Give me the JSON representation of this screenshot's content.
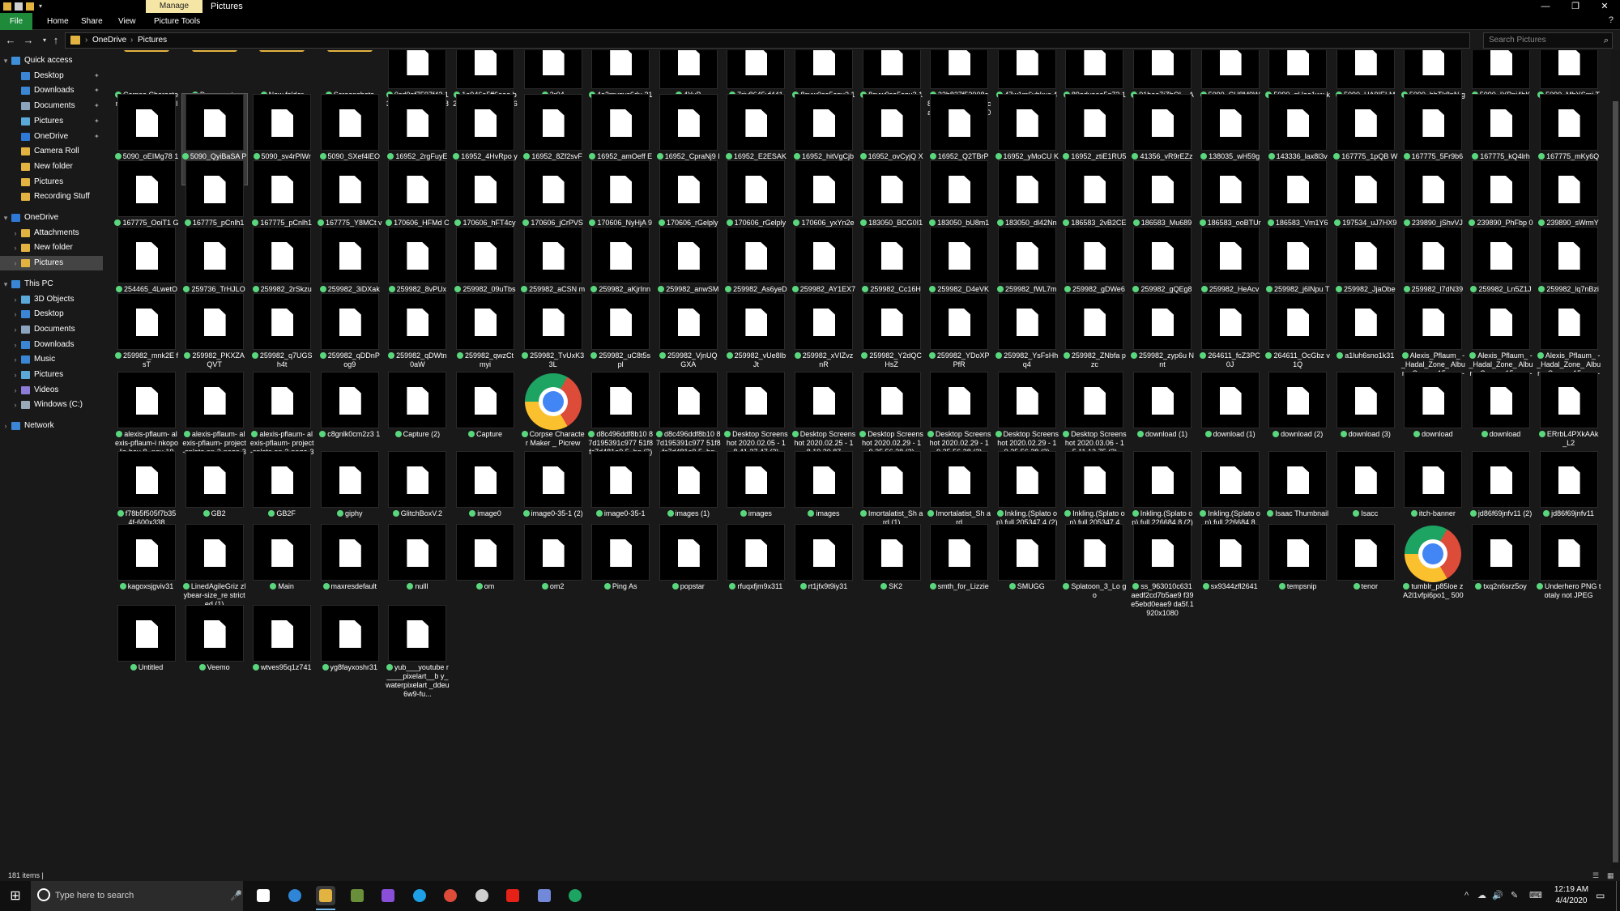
{
  "window": {
    "context_tab": "Manage",
    "title": "Pictures",
    "minimize": "—",
    "maximize": "❐",
    "close": "✕"
  },
  "ribbon": {
    "tabs": [
      "File",
      "Home",
      "Share",
      "View",
      "Picture Tools"
    ],
    "help": "?"
  },
  "address": {
    "crumbs": [
      "OneDrive",
      "Pictures"
    ],
    "separator": "›",
    "search_placeholder": "Search Pictures"
  },
  "nav": {
    "items": [
      {
        "label": "Quick access",
        "indent": 0,
        "icon": "star-icon",
        "color": "#3f8fd8",
        "pin": false,
        "expand": "▾"
      },
      {
        "label": "Desktop",
        "indent": 1,
        "icon": "desktop-icon",
        "color": "#3a86d4",
        "pin": true
      },
      {
        "label": "Downloads",
        "indent": 1,
        "icon": "downloads-icon",
        "color": "#3a86d4",
        "pin": true
      },
      {
        "label": "Documents",
        "indent": 1,
        "icon": "documents-icon",
        "color": "#8ca3bd",
        "pin": true
      },
      {
        "label": "Pictures",
        "indent": 1,
        "icon": "pictures-icon",
        "color": "#5aa9d8",
        "pin": true
      },
      {
        "label": "OneDrive",
        "indent": 1,
        "icon": "onedrive-icon",
        "color": "#2e78d6",
        "pin": true
      },
      {
        "label": "Camera Roll",
        "indent": 1,
        "icon": "folder-icon",
        "color": "#e3b341",
        "pin": false
      },
      {
        "label": "New folder",
        "indent": 1,
        "icon": "folder-icon",
        "color": "#e3b341",
        "pin": false
      },
      {
        "label": "Pictures",
        "indent": 1,
        "icon": "folder-icon",
        "color": "#e3b341",
        "pin": false
      },
      {
        "label": "Recording Stuff",
        "indent": 1,
        "icon": "folder-icon",
        "color": "#e3b341",
        "pin": false
      },
      {
        "label": "",
        "indent": 0,
        "icon": "",
        "color": "",
        "pin": false,
        "spacer": true
      },
      {
        "label": "OneDrive",
        "indent": 0,
        "icon": "onedrive-icon",
        "color": "#2e78d6",
        "pin": false,
        "expand": "▾"
      },
      {
        "label": "Attachments",
        "indent": 1,
        "icon": "folder-icon",
        "color": "#e3b341",
        "pin": false,
        "expand": "›"
      },
      {
        "label": "New folder",
        "indent": 1,
        "icon": "folder-icon",
        "color": "#e3b341",
        "pin": false,
        "expand": "›"
      },
      {
        "label": "Pictures",
        "indent": 1,
        "icon": "folder-icon",
        "color": "#e3b341",
        "pin": false,
        "expand": "›",
        "selected": true
      },
      {
        "label": "",
        "indent": 0,
        "icon": "",
        "color": "",
        "pin": false,
        "spacer": true
      },
      {
        "label": "This PC",
        "indent": 0,
        "icon": "pc-icon",
        "color": "#3a86d4",
        "pin": false,
        "expand": "▾"
      },
      {
        "label": "3D Objects",
        "indent": 1,
        "icon": "3d-objects-icon",
        "color": "#5aa9d8",
        "pin": false,
        "expand": "›"
      },
      {
        "label": "Desktop",
        "indent": 1,
        "icon": "desktop-icon",
        "color": "#3a86d4",
        "pin": false,
        "expand": "›"
      },
      {
        "label": "Documents",
        "indent": 1,
        "icon": "documents-icon",
        "color": "#8ca3bd",
        "pin": false,
        "expand": "›"
      },
      {
        "label": "Downloads",
        "indent": 1,
        "icon": "downloads-icon",
        "color": "#3a86d4",
        "pin": false,
        "expand": "›"
      },
      {
        "label": "Music",
        "indent": 1,
        "icon": "music-icon",
        "color": "#3a86d4",
        "pin": false,
        "expand": "›"
      },
      {
        "label": "Pictures",
        "indent": 1,
        "icon": "pictures-icon",
        "color": "#5aa9d8",
        "pin": false,
        "expand": "›"
      },
      {
        "label": "Videos",
        "indent": 1,
        "icon": "videos-icon",
        "color": "#8c7bd8",
        "pin": false,
        "expand": "›"
      },
      {
        "label": "Windows (C:)",
        "indent": 1,
        "icon": "drive-icon",
        "color": "#9aa9b8",
        "pin": false,
        "expand": "›"
      },
      {
        "label": "",
        "indent": 0,
        "icon": "",
        "color": "",
        "pin": false,
        "spacer": true
      },
      {
        "label": "Network",
        "indent": 0,
        "icon": "network-icon",
        "color": "#3a86d4",
        "pin": false,
        "expand": "›"
      }
    ]
  },
  "files": [
    {
      "name": "Corpse Character Maker_ Picrew_files",
      "type": "folder"
    },
    {
      "name": "Documents",
      "type": "folder"
    },
    {
      "name": "New folder",
      "type": "folder"
    },
    {
      "name": "Screenshots",
      "type": "folder"
    },
    {
      "name": "0cd0af7597f43 130e4a44c3358 848621ec8cca0 d",
      "type": "file"
    },
    {
      "name": "1e946a5ff6eea b22a65ce48928 e8f692",
      "type": "file"
    },
    {
      "name": "3r04",
      "type": "file"
    },
    {
      "name": "4o2mvqyc6du 31",
      "type": "file"
    },
    {
      "name": "4YuB",
      "type": "file"
    },
    {
      "name": "7riv8645vf441",
      "type": "file"
    },
    {
      "name": "8syw0sa5cqu2 1",
      "type": "file"
    },
    {
      "name": "8syw0sa5cqu2 1_LI",
      "type": "file"
    },
    {
      "name": "32b827f53008e 870c11a9e930e f1ca3767433ec 8r1-2048-204...",
      "type": "file"
    },
    {
      "name": "47w1m6yhkuc 41",
      "type": "file"
    },
    {
      "name": "89odyaeo5q73 1",
      "type": "file"
    },
    {
      "name": "91bee7jZbOL_ AC_UL320_ML 3_",
      "type": "file"
    },
    {
      "name": "5090_CU8M9W AF",
      "type": "file"
    },
    {
      "name": "5090_gUoa1wx k",
      "type": "file"
    },
    {
      "name": "5090_HA9IELM b",
      "type": "file"
    },
    {
      "name": "5090_hhTk8pN g",
      "type": "file"
    },
    {
      "name": "5090_IYPpj4hK g",
      "type": "file"
    },
    {
      "name": "5090_MhYSmj TT",
      "type": "file"
    },
    {
      "name": "5090_oEIMg78 1",
      "type": "file"
    },
    {
      "name": "5090_QyiBaSA P",
      "type": "file",
      "selected": true
    },
    {
      "name": "5090_sv4rPlWr",
      "type": "file"
    },
    {
      "name": "5090_SXef4lEO",
      "type": "file"
    },
    {
      "name": "16952_2rgFuyE G",
      "type": "file"
    },
    {
      "name": "16952_4HvRpo yr",
      "type": "file"
    },
    {
      "name": "16952_8Zf2svF u",
      "type": "file"
    },
    {
      "name": "16952_amOeff EE",
      "type": "file"
    },
    {
      "name": "16952_CpraNj9 I",
      "type": "file"
    },
    {
      "name": "16952_E2ESAKE s",
      "type": "file"
    },
    {
      "name": "16952_hitVgCjb",
      "type": "file"
    },
    {
      "name": "16952_ovCyjQ X3",
      "type": "file"
    },
    {
      "name": "16952_Q2TBrP Eu",
      "type": "file"
    },
    {
      "name": "16952_yMoCU K1C",
      "type": "file"
    },
    {
      "name": "16952_ztiE1RU5",
      "type": "file"
    },
    {
      "name": "41356_vR9rEZz E",
      "type": "file"
    },
    {
      "name": "138035_wH59g bsn",
      "type": "file"
    },
    {
      "name": "143336_lax8l3v b",
      "type": "file"
    },
    {
      "name": "167775_1pQB WMZx",
      "type": "file"
    },
    {
      "name": "167775_5Fr9b6 y1",
      "type": "file"
    },
    {
      "name": "167775_kQ4lrh NK",
      "type": "file"
    },
    {
      "name": "167775_mKy6Q Pz7",
      "type": "file"
    },
    {
      "name": "167775_OoiT1 GQ7",
      "type": "file"
    },
    {
      "name": "167775_pCnlh1 Hm (1)",
      "type": "file"
    },
    {
      "name": "167775_pCnlh1 Hm",
      "type": "file"
    },
    {
      "name": "167775_Y8MCt vxB",
      "type": "file"
    },
    {
      "name": "170606_HFMd CnaO",
      "type": "file"
    },
    {
      "name": "170606_hFT4cy 4T",
      "type": "file"
    },
    {
      "name": "170606_jCrPVS Nt",
      "type": "file"
    },
    {
      "name": "170606_NyHjA 9zC",
      "type": "file"
    },
    {
      "name": "170606_rGelply b (1)",
      "type": "file"
    },
    {
      "name": "170606_rGelply b",
      "type": "file"
    },
    {
      "name": "170606_yxYn2e tl",
      "type": "file"
    },
    {
      "name": "183050_BCG0I1 B7",
      "type": "file"
    },
    {
      "name": "183050_bU8m1 RLu",
      "type": "file"
    },
    {
      "name": "183050_dl42Nn dB",
      "type": "file"
    },
    {
      "name": "186583_2vB2CE MY",
      "type": "file"
    },
    {
      "name": "186583_Mu689 O3V",
      "type": "file"
    },
    {
      "name": "186583_ooBTUr zD (1)",
      "type": "file"
    },
    {
      "name": "186583_Vm1Y6 Qx6",
      "type": "file"
    },
    {
      "name": "197534_uJ7HX9 kL",
      "type": "file"
    },
    {
      "name": "239890_jShvVJ MF",
      "type": "file"
    },
    {
      "name": "239890_PhFbp 04I",
      "type": "file"
    },
    {
      "name": "239890_sWrmY qdO",
      "type": "file"
    },
    {
      "name": "254465_4LwetO sO",
      "type": "file"
    },
    {
      "name": "259736_TrHJLO eo",
      "type": "file"
    },
    {
      "name": "259982_2rSkzu cs",
      "type": "file"
    },
    {
      "name": "259982_3iDXak 3v",
      "type": "file"
    },
    {
      "name": "259982_8vPUx mxZ",
      "type": "file"
    },
    {
      "name": "259982_09uTbs g7",
      "type": "file"
    },
    {
      "name": "259982_aCSN mo60",
      "type": "file"
    },
    {
      "name": "259982_aKjrInn D",
      "type": "file"
    },
    {
      "name": "259982_anwSM qZj",
      "type": "file"
    },
    {
      "name": "259982_As6yeD fU",
      "type": "file"
    },
    {
      "name": "259982_AY1EX7 Od",
      "type": "file"
    },
    {
      "name": "259982_Cc16H 6uf",
      "type": "file"
    },
    {
      "name": "259982_D4eVK TCf",
      "type": "file"
    },
    {
      "name": "259982_fWL7m yqS",
      "type": "file"
    },
    {
      "name": "259982_gDWe6 eV0",
      "type": "file"
    },
    {
      "name": "259982_gQEg8 vsJ",
      "type": "file"
    },
    {
      "name": "259982_HeAcv NT9",
      "type": "file"
    },
    {
      "name": "259982_j6lNpu TB",
      "type": "file"
    },
    {
      "name": "259982_JjaObe K5",
      "type": "file"
    },
    {
      "name": "259982_l7dN39 wl",
      "type": "file"
    },
    {
      "name": "259982_Ln5Z1J nW",
      "type": "file"
    },
    {
      "name": "259982_lq7nBzi e",
      "type": "file"
    },
    {
      "name": "259982_mnk2E fsT",
      "type": "file"
    },
    {
      "name": "259982_PKXZA QVT",
      "type": "file"
    },
    {
      "name": "259982_q7UGS h4t",
      "type": "file"
    },
    {
      "name": "259982_qDDnP og9",
      "type": "file"
    },
    {
      "name": "259982_qDWtn 0aW",
      "type": "file"
    },
    {
      "name": "259982_qwzCt myi",
      "type": "file"
    },
    {
      "name": "259982_TvUxK3 3L",
      "type": "file"
    },
    {
      "name": "259982_uC8t5s pl",
      "type": "file"
    },
    {
      "name": "259982_VjnUQ GXA",
      "type": "file"
    },
    {
      "name": "259982_vUe8Ib Jt",
      "type": "file"
    },
    {
      "name": "259982_xVIZvz nR",
      "type": "file"
    },
    {
      "name": "259982_Y2dQC HsZ",
      "type": "file"
    },
    {
      "name": "259982_YDoXP PfR",
      "type": "file"
    },
    {
      "name": "259982_YsFsHh q4",
      "type": "file"
    },
    {
      "name": "259982_ZNbfa pzc",
      "type": "file"
    },
    {
      "name": "259982_zyp6u Nnt",
      "type": "file"
    },
    {
      "name": "264611_fcZ3PC 0J",
      "type": "file"
    },
    {
      "name": "264611_OcGbz v1Q",
      "type": "file"
    },
    {
      "name": "a1luh6sno1k31",
      "type": "file"
    },
    {
      "name": "Alexis_Pflaum_ -_Hadal_Zone_ Album_Cover_ 15-may-19 (2)",
      "type": "file"
    },
    {
      "name": "Alexis_Pflaum_ -_Hadal_Zone_ Album_Cover_ 15-may-19 (3)",
      "type": "file"
    },
    {
      "name": "Alexis_Pflaum_ -_Hadal_Zone_ Album_Cover_ 15-may-19",
      "type": "file"
    },
    {
      "name": "alexis-pflaum- alexis-pflaum-i nkopolis-bay-8 -nov-19",
      "type": "file"
    },
    {
      "name": "alexis-pflaum- alexis-pflaum- project-splato on-3-page-36",
      "type": "file"
    },
    {
      "name": "alexis-pflaum- alexis-pflaum- project-splato on-3-page-38",
      "type": "file"
    },
    {
      "name": "c8gnlk0cm2z3 1",
      "type": "file"
    },
    {
      "name": "Capture (2)",
      "type": "file"
    },
    {
      "name": "Capture",
      "type": "file"
    },
    {
      "name": "Corpse Character Maker _ Picrew",
      "type": "chrome"
    },
    {
      "name": "d8c496ddf8b10 87d195391c977 51f8fc7d481e9 5_hq (2)",
      "type": "file"
    },
    {
      "name": "d8c496ddf8b10 87d195391c977 51f8fc7d481e9 5_hq",
      "type": "file"
    },
    {
      "name": "Desktop Screenshot 2020.02.05 - 18.41.37.47 (2)",
      "type": "file"
    },
    {
      "name": "Desktop Screenshot 2020.02.25 - 18.19.30.87",
      "type": "file"
    },
    {
      "name": "Desktop Screenshot 2020.02.29 - 19.25.56.28 (2)",
      "type": "file"
    },
    {
      "name": "Desktop Screenshot 2020.02.29 - 19.25.56.28 (2)",
      "type": "file"
    },
    {
      "name": "Desktop Screenshot 2020.02.29 - 19.25.56.28 (3)",
      "type": "file"
    },
    {
      "name": "Desktop Screenshot 2020.03.06 - 15.11.13.75 (2)",
      "type": "file"
    },
    {
      "name": "download (1)",
      "type": "file"
    },
    {
      "name": "download (1)",
      "type": "file"
    },
    {
      "name": "download (2)",
      "type": "file"
    },
    {
      "name": "download (3)",
      "type": "file"
    },
    {
      "name": "download",
      "type": "file"
    },
    {
      "name": "download",
      "type": "file"
    },
    {
      "name": "ERrbL4PXkAAk _L2",
      "type": "file"
    },
    {
      "name": "f78b5f505f7b35 4f-600x338",
      "type": "file"
    },
    {
      "name": "GB2",
      "type": "file"
    },
    {
      "name": "GB2F",
      "type": "file"
    },
    {
      "name": "giphy",
      "type": "file"
    },
    {
      "name": "GlitchBoxV.2",
      "type": "file"
    },
    {
      "name": "image0",
      "type": "file"
    },
    {
      "name": "image0-35-1 (2)",
      "type": "file"
    },
    {
      "name": "image0-35-1",
      "type": "file"
    },
    {
      "name": "images (1)",
      "type": "file"
    },
    {
      "name": "images",
      "type": "file"
    },
    {
      "name": "images",
      "type": "file"
    },
    {
      "name": "Imortalatist_Sh ard (1)",
      "type": "file"
    },
    {
      "name": "Imortalatist_Sh ard",
      "type": "file"
    },
    {
      "name": "Inkling.(Splato on).full.205347 4 (2)",
      "type": "file"
    },
    {
      "name": "Inkling.(Splato on).full.205347 4",
      "type": "file"
    },
    {
      "name": "Inkling.(Splato on).full.226684 8 (2)",
      "type": "file"
    },
    {
      "name": "Inkling.(Splato on).full.226684 8",
      "type": "file"
    },
    {
      "name": "Isaac Thumbnail",
      "type": "file"
    },
    {
      "name": "Isacc",
      "type": "file"
    },
    {
      "name": "itch-banner",
      "type": "file"
    },
    {
      "name": "jd86f69jnfv11 (2)",
      "type": "file"
    },
    {
      "name": "jd86f69jnfv11",
      "type": "file"
    },
    {
      "name": "kagoxsjgviv31",
      "type": "file"
    },
    {
      "name": "LinedAgileGriz zlybear-size_re stricted (1)",
      "type": "file"
    },
    {
      "name": "Main",
      "type": "file"
    },
    {
      "name": "maxresdefault",
      "type": "file"
    },
    {
      "name": "nulll",
      "type": "file"
    },
    {
      "name": "om",
      "type": "file"
    },
    {
      "name": "om2",
      "type": "file"
    },
    {
      "name": "Ping As",
      "type": "file"
    },
    {
      "name": "popstar",
      "type": "file"
    },
    {
      "name": "rfuqxfjm9x311",
      "type": "file"
    },
    {
      "name": "rt1jfx9t9iy31",
      "type": "file"
    },
    {
      "name": "SK2",
      "type": "file"
    },
    {
      "name": "smth_for_Lizzie",
      "type": "file"
    },
    {
      "name": "SMUGG",
      "type": "file"
    },
    {
      "name": "Splatoon_3_Lo go",
      "type": "file"
    },
    {
      "name": "ss_963010c631 aedf2cd7b5ae9 f39e5ebd0eae9 da5f.1920x1080",
      "type": "file"
    },
    {
      "name": "sx9344zfl2641",
      "type": "file"
    },
    {
      "name": "tempsnip",
      "type": "file"
    },
    {
      "name": "tenor",
      "type": "file"
    },
    {
      "name": "tumblr_p85loe zA2l1vfpi6po1_ 500",
      "type": "chrome"
    },
    {
      "name": "txq2n6srz5oy",
      "type": "file"
    },
    {
      "name": "Underhero PNG totaly not JPEG",
      "type": "file"
    },
    {
      "name": "Untitled",
      "type": "file"
    },
    {
      "name": "Veemo",
      "type": "file"
    },
    {
      "name": "wtves95q1z741",
      "type": "file"
    },
    {
      "name": "yg8fayxoshr31",
      "type": "file"
    },
    {
      "name": "yub___youtube r____pixelart__b y_waterpixelart _ddeu6w9-fu...",
      "type": "file"
    }
  ],
  "status": {
    "count": "181 items",
    "sep": "|"
  },
  "taskbar": {
    "search_placeholder": "Type here to search",
    "icons": [
      {
        "name": "task-view-icon",
        "color": "#ffffff"
      },
      {
        "name": "edge-icon",
        "color": "#2f86d6"
      },
      {
        "name": "file-explorer-icon",
        "color": "#e3b341",
        "active": true
      },
      {
        "name": "minecraft-icon",
        "color": "#6a8f3a"
      },
      {
        "name": "app-purple-icon",
        "color": "#8a4fd8"
      },
      {
        "name": "skype-icon",
        "color": "#1ea0e6"
      },
      {
        "name": "chrome-icon",
        "color": "#dd4b39"
      },
      {
        "name": "obs-icon",
        "color": "#cfcfcf"
      },
      {
        "name": "youtube-icon",
        "color": "#e62117"
      },
      {
        "name": "discord-chrome-icon",
        "color": "#7289da"
      },
      {
        "name": "chrome-2-icon",
        "color": "#1da462"
      }
    ],
    "tray": [
      "^",
      "☁",
      "🔊",
      "✎",
      "⌨"
    ],
    "time": "12:19 AM",
    "date": "4/4/2020",
    "notif": "▭"
  }
}
